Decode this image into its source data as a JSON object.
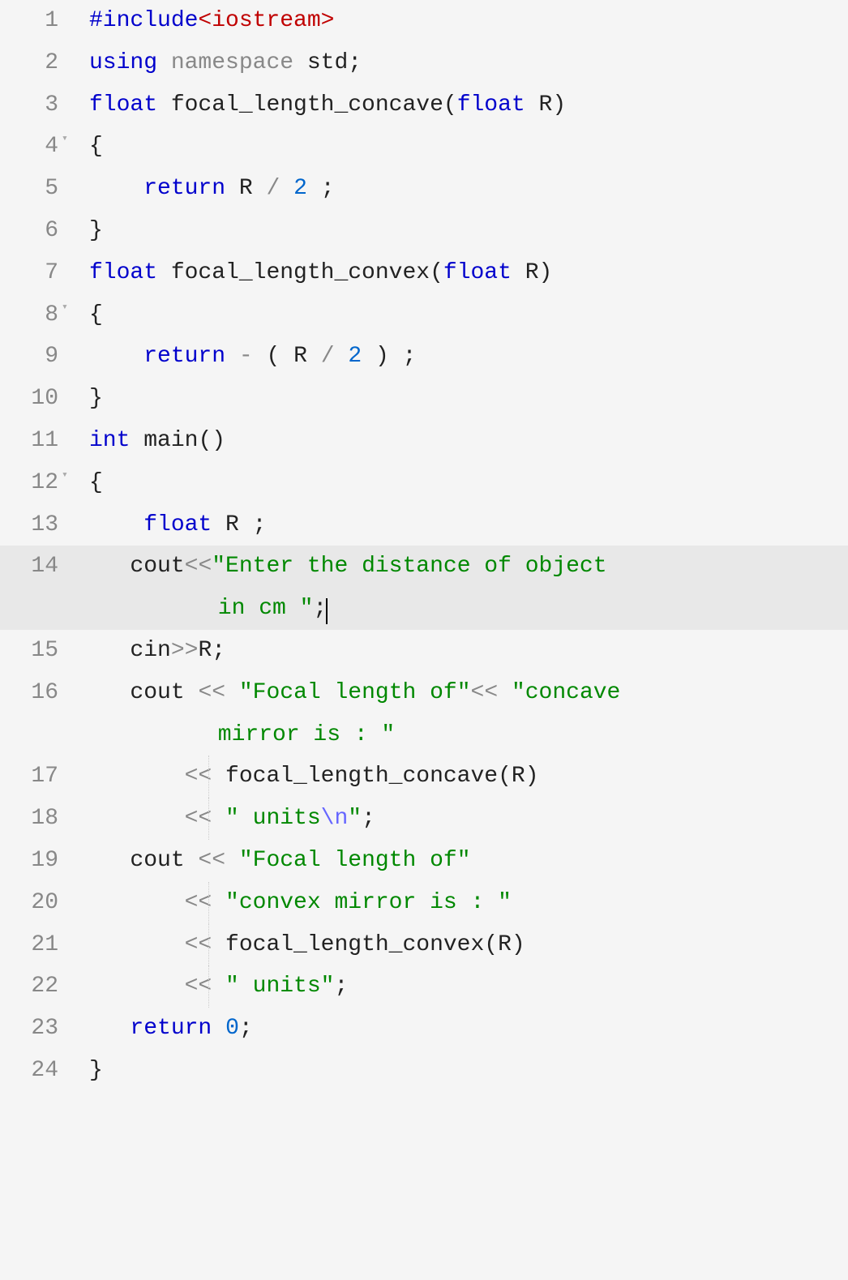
{
  "language": "cpp",
  "highlighted_line": 14,
  "lines": [
    {
      "n": 1,
      "fold": false,
      "segments": [
        {
          "c": "pp",
          "t": "#include"
        },
        {
          "c": "pp-angle",
          "t": "<iostream>"
        }
      ]
    },
    {
      "n": 2,
      "fold": false,
      "segments": [
        {
          "c": "kw",
          "t": "using"
        },
        {
          "c": "id",
          "t": " "
        },
        {
          "c": "ns",
          "t": "namespace"
        },
        {
          "c": "id",
          "t": " std"
        },
        {
          "c": "punct",
          "t": ";"
        }
      ]
    },
    {
      "n": 3,
      "fold": false,
      "segments": [
        {
          "c": "kw",
          "t": "float"
        },
        {
          "c": "id",
          "t": " focal_length_concave"
        },
        {
          "c": "paren",
          "t": "("
        },
        {
          "c": "kw",
          "t": "float"
        },
        {
          "c": "id",
          "t": " R"
        },
        {
          "c": "paren",
          "t": ")"
        }
      ]
    },
    {
      "n": 4,
      "fold": true,
      "segments": [
        {
          "c": "punct",
          "t": "{"
        }
      ]
    },
    {
      "n": 5,
      "fold": false,
      "segments": [
        {
          "c": "id",
          "t": "    "
        },
        {
          "c": "kw",
          "t": "return"
        },
        {
          "c": "id",
          "t": " R "
        },
        {
          "c": "op",
          "t": "/"
        },
        {
          "c": "id",
          "t": " "
        },
        {
          "c": "num",
          "t": "2"
        },
        {
          "c": "id",
          "t": " "
        },
        {
          "c": "punct",
          "t": ";"
        }
      ]
    },
    {
      "n": 6,
      "fold": false,
      "segments": [
        {
          "c": "punct",
          "t": "}"
        }
      ]
    },
    {
      "n": 7,
      "fold": false,
      "segments": [
        {
          "c": "kw",
          "t": "float"
        },
        {
          "c": "id",
          "t": " focal_length_convex"
        },
        {
          "c": "paren",
          "t": "("
        },
        {
          "c": "kw",
          "t": "float"
        },
        {
          "c": "id",
          "t": " R"
        },
        {
          "c": "paren",
          "t": ")"
        }
      ]
    },
    {
      "n": 8,
      "fold": true,
      "segments": [
        {
          "c": "punct",
          "t": "{"
        }
      ]
    },
    {
      "n": 9,
      "fold": false,
      "segments": [
        {
          "c": "id",
          "t": "    "
        },
        {
          "c": "kw",
          "t": "return"
        },
        {
          "c": "id",
          "t": " "
        },
        {
          "c": "op",
          "t": "-"
        },
        {
          "c": "id",
          "t": " "
        },
        {
          "c": "paren",
          "t": "("
        },
        {
          "c": "id",
          "t": " R "
        },
        {
          "c": "op",
          "t": "/"
        },
        {
          "c": "id",
          "t": " "
        },
        {
          "c": "num",
          "t": "2"
        },
        {
          "c": "id",
          "t": " "
        },
        {
          "c": "paren",
          "t": ")"
        },
        {
          "c": "id",
          "t": " "
        },
        {
          "c": "punct",
          "t": ";"
        }
      ]
    },
    {
      "n": 10,
      "fold": false,
      "segments": [
        {
          "c": "punct",
          "t": "}"
        }
      ]
    },
    {
      "n": 11,
      "fold": false,
      "segments": [
        {
          "c": "kw",
          "t": "int"
        },
        {
          "c": "id",
          "t": " main"
        },
        {
          "c": "paren",
          "t": "()"
        }
      ]
    },
    {
      "n": 12,
      "fold": true,
      "segments": [
        {
          "c": "punct",
          "t": "{"
        }
      ]
    },
    {
      "n": 13,
      "fold": false,
      "segments": [
        {
          "c": "id",
          "t": "    "
        },
        {
          "c": "kw",
          "t": "float"
        },
        {
          "c": "id",
          "t": " R "
        },
        {
          "c": "punct",
          "t": ";"
        }
      ]
    },
    {
      "n": 14,
      "fold": false,
      "wrap": true,
      "cursor_after": true,
      "row1": [
        {
          "c": "id",
          "t": "   cout"
        },
        {
          "c": "op",
          "t": "<<"
        },
        {
          "c": "str",
          "t": "\"Enter the distance of object"
        }
      ],
      "row2": [
        {
          "c": "str",
          "t": " in cm \""
        },
        {
          "c": "punct",
          "t": ";"
        }
      ]
    },
    {
      "n": 15,
      "fold": false,
      "segments": [
        {
          "c": "id",
          "t": "   cin"
        },
        {
          "c": "op",
          "t": ">>"
        },
        {
          "c": "id",
          "t": "R"
        },
        {
          "c": "punct",
          "t": ";"
        }
      ]
    },
    {
      "n": 16,
      "fold": false,
      "wrap": true,
      "row1": [
        {
          "c": "id",
          "t": "   cout "
        },
        {
          "c": "op",
          "t": "<<"
        },
        {
          "c": "id",
          "t": " "
        },
        {
          "c": "str",
          "t": "\"Focal length of\""
        },
        {
          "c": "op",
          "t": "<<"
        },
        {
          "c": "id",
          "t": " "
        },
        {
          "c": "str",
          "t": "\"concave"
        }
      ],
      "row2": [
        {
          "c": "str",
          "t": " mirror is : \""
        }
      ]
    },
    {
      "n": 17,
      "fold": false,
      "guide": true,
      "segments": [
        {
          "c": "id",
          "t": "       "
        },
        {
          "c": "op",
          "t": "<<"
        },
        {
          "c": "id",
          "t": " focal_length_concave"
        },
        {
          "c": "paren",
          "t": "("
        },
        {
          "c": "id",
          "t": "R"
        },
        {
          "c": "paren",
          "t": ")"
        }
      ]
    },
    {
      "n": 18,
      "fold": false,
      "guide": true,
      "segments": [
        {
          "c": "id",
          "t": "       "
        },
        {
          "c": "op",
          "t": "<<"
        },
        {
          "c": "id",
          "t": " "
        },
        {
          "c": "str",
          "t": "\" units"
        },
        {
          "c": "esc",
          "t": "\\n"
        },
        {
          "c": "str",
          "t": "\""
        },
        {
          "c": "punct",
          "t": ";"
        }
      ]
    },
    {
      "n": 19,
      "fold": false,
      "segments": [
        {
          "c": "id",
          "t": "   cout "
        },
        {
          "c": "op",
          "t": "<<"
        },
        {
          "c": "id",
          "t": " "
        },
        {
          "c": "str",
          "t": "\"Focal length of\""
        }
      ]
    },
    {
      "n": 20,
      "fold": false,
      "guide": true,
      "segments": [
        {
          "c": "id",
          "t": "       "
        },
        {
          "c": "op",
          "t": "<<"
        },
        {
          "c": "id",
          "t": " "
        },
        {
          "c": "str",
          "t": "\"convex mirror is : \""
        }
      ]
    },
    {
      "n": 21,
      "fold": false,
      "guide": true,
      "segments": [
        {
          "c": "id",
          "t": "       "
        },
        {
          "c": "op",
          "t": "<<"
        },
        {
          "c": "id",
          "t": " focal_length_convex"
        },
        {
          "c": "paren",
          "t": "("
        },
        {
          "c": "id",
          "t": "R"
        },
        {
          "c": "paren",
          "t": ")"
        }
      ]
    },
    {
      "n": 22,
      "fold": false,
      "guide": true,
      "segments": [
        {
          "c": "id",
          "t": "       "
        },
        {
          "c": "op",
          "t": "<<"
        },
        {
          "c": "id",
          "t": " "
        },
        {
          "c": "str",
          "t": "\" units\""
        },
        {
          "c": "punct",
          "t": ";"
        }
      ]
    },
    {
      "n": 23,
      "fold": false,
      "segments": [
        {
          "c": "id",
          "t": "   "
        },
        {
          "c": "kw",
          "t": "return"
        },
        {
          "c": "id",
          "t": " "
        },
        {
          "c": "num",
          "t": "0"
        },
        {
          "c": "punct",
          "t": ";"
        }
      ]
    },
    {
      "n": 24,
      "fold": false,
      "segments": [
        {
          "c": "punct",
          "t": "}"
        }
      ]
    }
  ]
}
